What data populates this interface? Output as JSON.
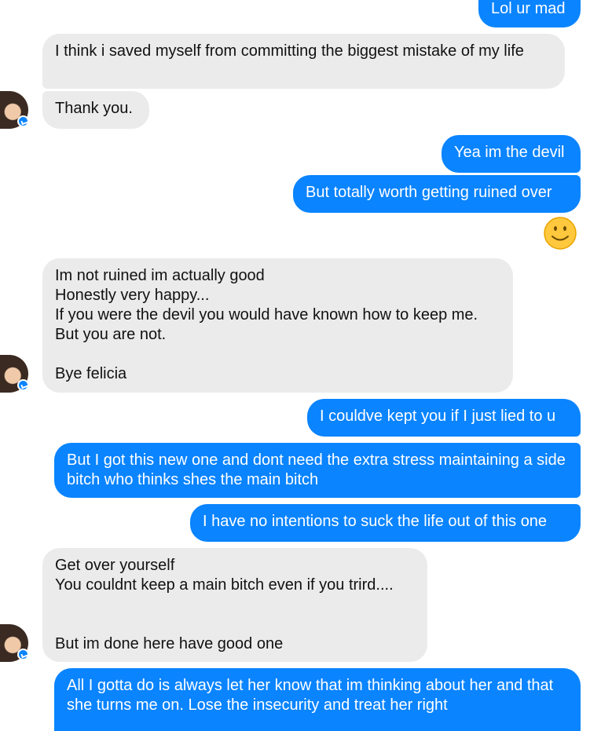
{
  "conversation": {
    "messages": [
      {
        "id": "m1",
        "side": "out",
        "text": "Lol ur mad"
      },
      {
        "id": "m2",
        "side": "in",
        "text": "I think i saved myself from committing the biggest mistake of my life"
      },
      {
        "id": "m3",
        "side": "in",
        "text": "Thank you."
      },
      {
        "id": "m4",
        "side": "out",
        "text": "Yea im the devil"
      },
      {
        "id": "m5",
        "side": "out",
        "text": "But totally worth getting ruined over"
      },
      {
        "id": "m6",
        "side": "out",
        "text": "",
        "emoji": "smiley-emoji"
      },
      {
        "id": "m7",
        "side": "in",
        "text": "Im not ruined im actually good\nHonestly very happy...\nIf you were the devil you would have known how to keep me.\nBut you are not.\n\nBye felicia"
      },
      {
        "id": "m8",
        "side": "out",
        "text": "I couldve kept you if I just lied to u"
      },
      {
        "id": "m9",
        "side": "out",
        "text": "But I got this new one and dont need the extra stress maintaining a side bitch who thinks shes the main bitch"
      },
      {
        "id": "m10",
        "side": "out",
        "text": "I have no intentions to suck the life out of this one"
      },
      {
        "id": "m11",
        "side": "in",
        "text": "Get over yourself\nYou couldnt keep a main bitch even if you trird....\n\n\nBut im done here have good one"
      },
      {
        "id": "m12",
        "side": "out",
        "text": "All I gotta do is always let her know that im thinking about her and that she turns me on. Lose the insecurity and treat her right"
      }
    ]
  },
  "colors": {
    "outgoing_bubble": "#0a84ff",
    "incoming_bubble": "#ebebeb",
    "background": "#ffffff"
  },
  "icons": {
    "avatar": "contact-avatar",
    "badge": "messenger-badge-icon",
    "emoji": "smiley-emoji"
  }
}
